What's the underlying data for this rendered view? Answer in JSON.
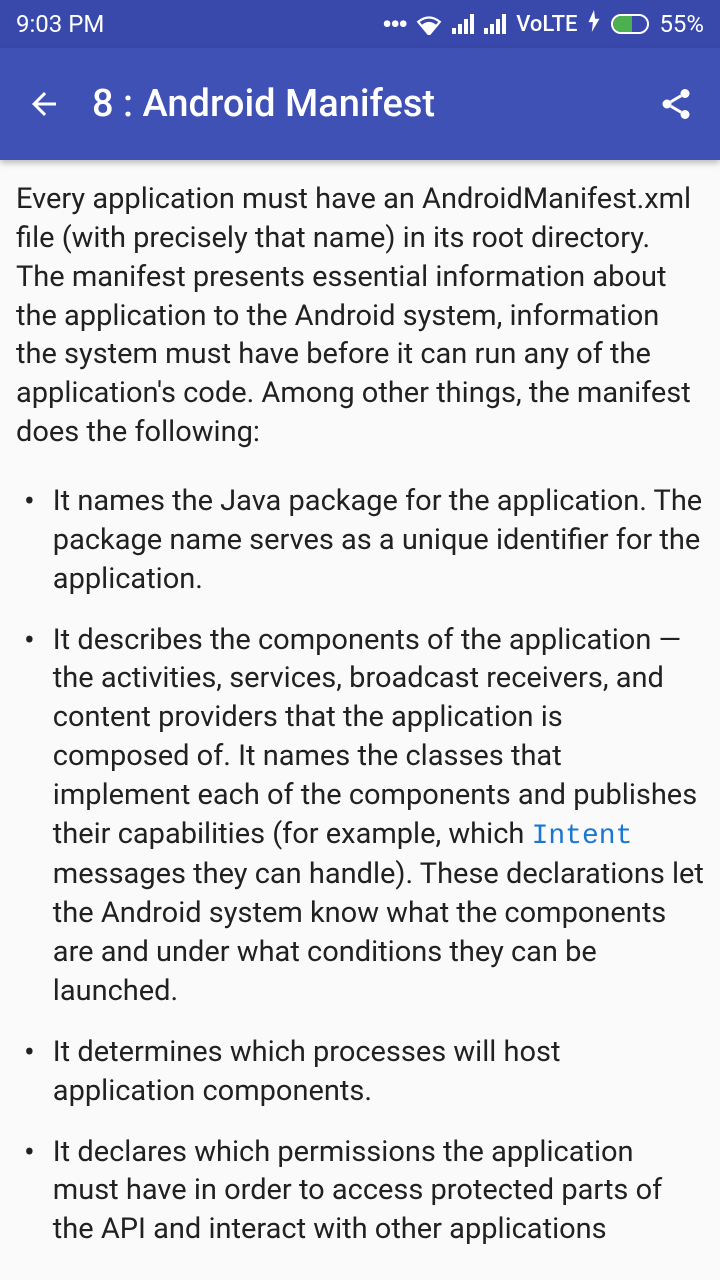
{
  "status_bar": {
    "time": "9:03 PM",
    "network_label": "VoLTE",
    "battery_percent": "55%"
  },
  "app_bar": {
    "title": "8 : Android Manifest"
  },
  "content": {
    "intro": "Every application must have an AndroidManifest.xml file (with precisely that name) in its root directory. The manifest presents essential information about the application to the Android system, information the system must have before it can run any of the application's code. Among other things, the manifest does the following:",
    "bullets": [
      {
        "text": "It names the Java package for the application. The package name serves as a unique identifier for the application."
      },
      {
        "text_before": "It describes the components of the application — the activities, services, broadcast receivers, and content providers that the application is composed of. It names the classes that implement each of the components and publishes their capabilities (for example, which ",
        "code": "Intent",
        "text_after": " messages they can handle). These declarations let the Android system know what the components are and under what conditions they can be launched."
      },
      {
        "text": "It determines which processes will host application components."
      },
      {
        "text": "It declares which permissions the application must have in order to access protected parts of the API and interact with other applications"
      }
    ]
  }
}
